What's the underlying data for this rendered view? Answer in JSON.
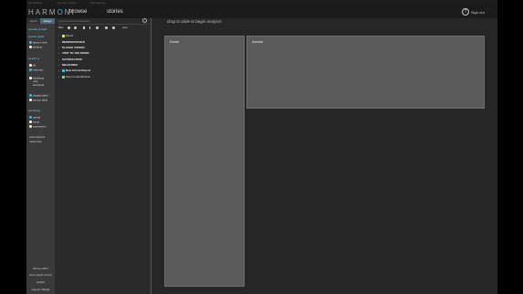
{
  "window": {
    "titlebar_texts": [
      "file  desktop",
      "harmoni insight",
      "help settings"
    ]
  },
  "topbar": {
    "logo_left": "HARM",
    "logo_o": "O",
    "logo_right": "NI",
    "nav": [
      "browse",
      "stories"
    ],
    "help_glyph": "?",
    "signout_label": "Sign out"
  },
  "left_panel": {
    "tabs": [
      "report",
      "design"
    ],
    "operation_label": "operations field",
    "search_depth_label": "search depth",
    "search_depth_options": [
      "deep in tree",
      "shallow"
    ],
    "search_label": "search in",
    "search_options": [
      "all",
      "selected",
      "headings",
      "only",
      "elements"
    ],
    "display_options": [
      "display label",
      "source label"
    ],
    "searching_label": "searching",
    "searching_options": [
      "partial",
      "exact",
      "expression"
    ],
    "links": [
      "reset options",
      "mode tree"
    ],
    "bottom_buttons": [
      "library editor",
      "view weight source",
      "publish",
      "support dialogs"
    ]
  },
  "variables": {
    "search_placeholder": "type here to find variables",
    "toolbar_label": "filter",
    "toolbar_new": "new",
    "items": [
      {
        "label": "Month",
        "bold": false,
        "color": "#cde07a"
      },
      {
        "label": "DEMOGRAPHICS",
        "bold": true,
        "color": ""
      },
      {
        "label": "PLACES VISITED",
        "bold": true,
        "color": ""
      },
      {
        "label": "VISIT TO THE MOON",
        "bold": true,
        "color": ""
      },
      {
        "label": "SATISFACTION",
        "bold": true,
        "color": ""
      },
      {
        "label": "MEASURES",
        "bold": true,
        "color": ""
      },
      {
        "label": "New Arrival Airport",
        "bold": true,
        "color": "#4fb3d9"
      },
      {
        "label": "Source Identification",
        "bold": false,
        "color": "#7ccf7c"
      }
    ]
  },
  "main": {
    "hint": "drag to table to begin analysis",
    "down_label": "Down",
    "across_label": "Across"
  },
  "colors": {
    "accent": "#4fb3d9",
    "zone_fill": "#5a5a5a"
  }
}
